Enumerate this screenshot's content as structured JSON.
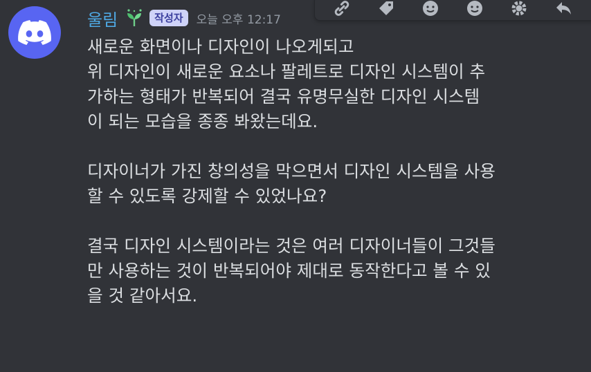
{
  "message": {
    "author": "울림",
    "tag": "작성자",
    "timestamp": "오늘 오후 12:17",
    "avatar_icon": "discord-logo-icon",
    "role_icon": "sprout-icon",
    "lines": [
      "새로운 화면이나 디자인이 나오게되고",
      "위 디자인이 새로운 요소나 팔레트로 디자인 시스템이 추",
      "가하는 형태가 반복되어 결국 유명무실한 디자인 시스템",
      "이 되는 모습을 종종 봐왔는데요.",
      "",
      "디자이너가 가진 창의성을 막으면서 디자인 시스템을 사용",
      "할 수 있도록 강제할 수 있었나요?",
      "",
      "결국 디자인 시스템이라는 것은 여러 디자이너들이 그것들",
      "만 사용하는 것이 반복되어야 제대로 동작한다고 볼 수 있",
      "을 것 같아서요."
    ]
  },
  "toolbar": {
    "icons": [
      "link-icon",
      "tag-icon",
      "emoji-icon",
      "emoji-icon",
      "gear-icon",
      "reply-icon"
    ]
  },
  "colors": {
    "background": "#313338",
    "accent": "#5865f2",
    "username": "#4fa9e4",
    "text": "#dbdee1",
    "muted": "#949ba4"
  }
}
